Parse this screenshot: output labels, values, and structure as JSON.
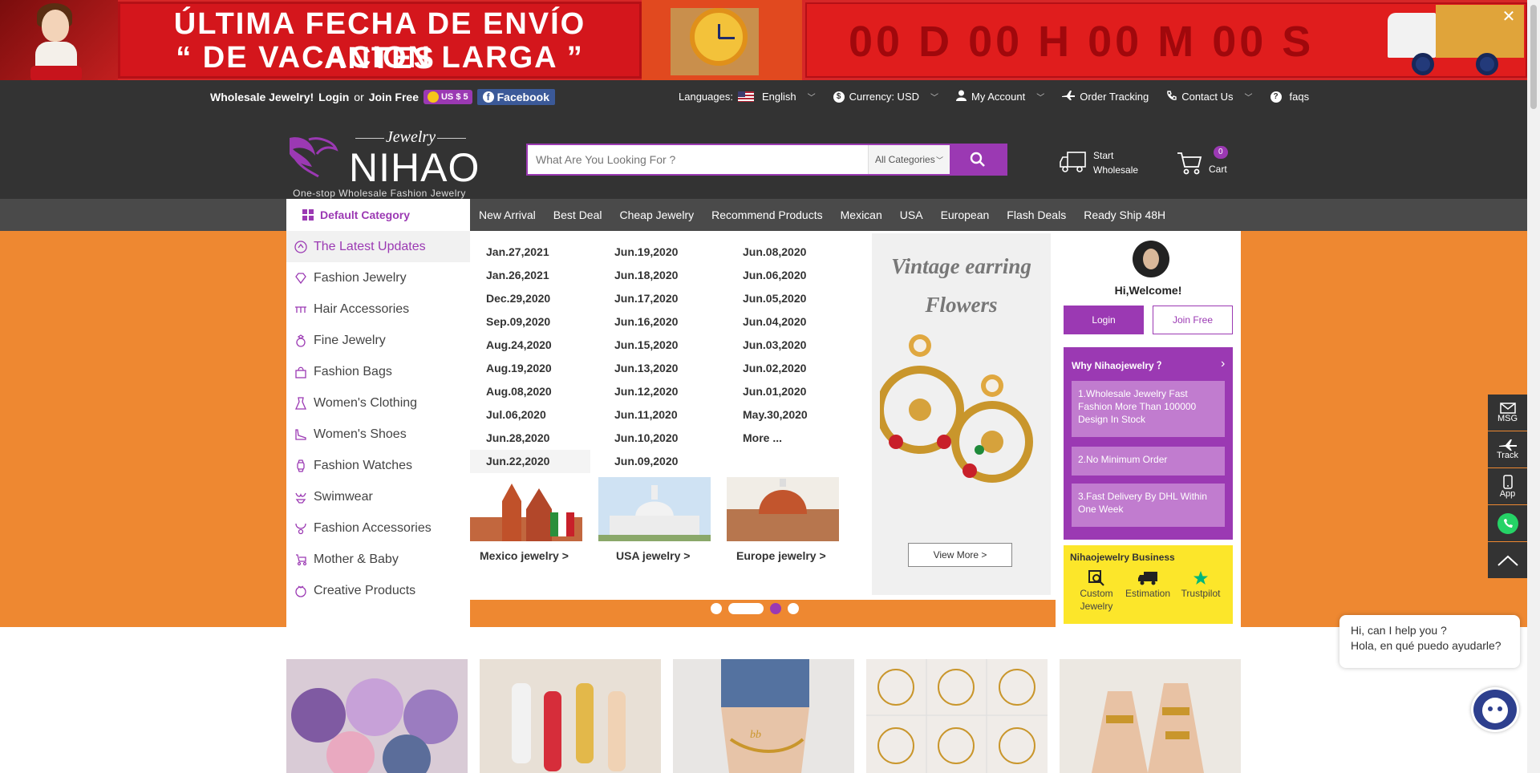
{
  "banner": {
    "line1": "ÚLTIMA FECHA DE ENVÍO ANTES",
    "line2": "“ DE VACACION LARGA ”",
    "countdown": "00 D 00 H 00 M 00 S",
    "close": "✕"
  },
  "topbar": {
    "wholesale": "Wholesale Jewelry!",
    "login": "Login",
    "or": "or",
    "join": "Join Free",
    "coin": "US $ 5",
    "facebook": "Facebook",
    "languages_label": "Languages:",
    "language": "English",
    "currency": "Currency: USD",
    "account": "My Account",
    "tracking": "Order Tracking",
    "contact": "Contact Us",
    "faqs": "faqs"
  },
  "header": {
    "logo_script": "Jewelry",
    "logo_name": "NIHAO",
    "tagline": "One-stop Wholesale Fashion Jewelry",
    "search_placeholder": "What Are You Looking For ?",
    "category": "All Categories",
    "start_wholesale_1": "Start",
    "start_wholesale_2": "Wholesale",
    "cart_count": "0",
    "cart": "Cart"
  },
  "nav": {
    "default_category": "Default Category",
    "links": [
      "New Arrival",
      "Best Deal",
      "Cheap Jewelry",
      "Recommend Products",
      "Mexican",
      "USA",
      "European",
      "Flash Deals",
      "Ready Ship 48H"
    ]
  },
  "sidebar": {
    "items": [
      {
        "label": "The Latest Updates"
      },
      {
        "label": "Fashion Jewelry"
      },
      {
        "label": "Hair Accessories"
      },
      {
        "label": "Fine Jewelry"
      },
      {
        "label": "Fashion Bags"
      },
      {
        "label": "Women's Clothing"
      },
      {
        "label": "Women's Shoes"
      },
      {
        "label": "Fashion Watches"
      },
      {
        "label": "Swimwear"
      },
      {
        "label": "Fashion Accessories"
      },
      {
        "label": "Mother & Baby"
      },
      {
        "label": "Creative Products"
      }
    ]
  },
  "dates": {
    "col1": [
      "Jan.27,2021",
      "Jan.26,2021",
      "Dec.29,2020",
      "Sep.09,2020",
      "Aug.24,2020",
      "Aug.19,2020",
      "Aug.08,2020",
      "Jul.06,2020",
      "Jun.28,2020",
      "Jun.22,2020"
    ],
    "col2": [
      "Jun.19,2020",
      "Jun.18,2020",
      "Jun.17,2020",
      "Jun.16,2020",
      "Jun.15,2020",
      "Jun.13,2020",
      "Jun.12,2020",
      "Jun.11,2020",
      "Jun.10,2020",
      "Jun.09,2020"
    ],
    "col3": [
      "Jun.08,2020",
      "Jun.06,2020",
      "Jun.05,2020",
      "Jun.04,2020",
      "Jun.03,2020",
      "Jun.02,2020",
      "Jun.01,2020",
      "May.30,2020",
      "More ..."
    ]
  },
  "promo": {
    "title1": "Vintage earring",
    "title2": "Flowers",
    "view_more": "View More >"
  },
  "regions": {
    "mexico": "Mexico jewelry >",
    "usa": "USA jewelry >",
    "europe": "Europe jewelry >"
  },
  "welcome": {
    "hi": "Hi,Welcome!",
    "login": "Login",
    "join": "Join Free",
    "why_title": "Why Nihaojewelry ？",
    "points": [
      "1.Wholesale Jewelry Fast Fashion More Than 100000 Design In Stock",
      "2.No Minimum Order",
      "3.Fast Delivery By DHL Within One Week"
    ],
    "business_title": "Nihaojewelry Business",
    "custom": "Custom Jewelry",
    "estimation": "Estimation",
    "trustpilot": "Trustpilot"
  },
  "rail": {
    "msg": "MSG",
    "track": "Track",
    "app": "App"
  },
  "chat": {
    "line1": "Hi, can I help you ?",
    "line2": "Hola, en qué puedo ayudarle?"
  },
  "colors": {
    "brand_purple": "#9b39b3",
    "hero_orange": "#ee8831",
    "dark_bar": "#333333",
    "business_yellow": "#fce62a"
  }
}
